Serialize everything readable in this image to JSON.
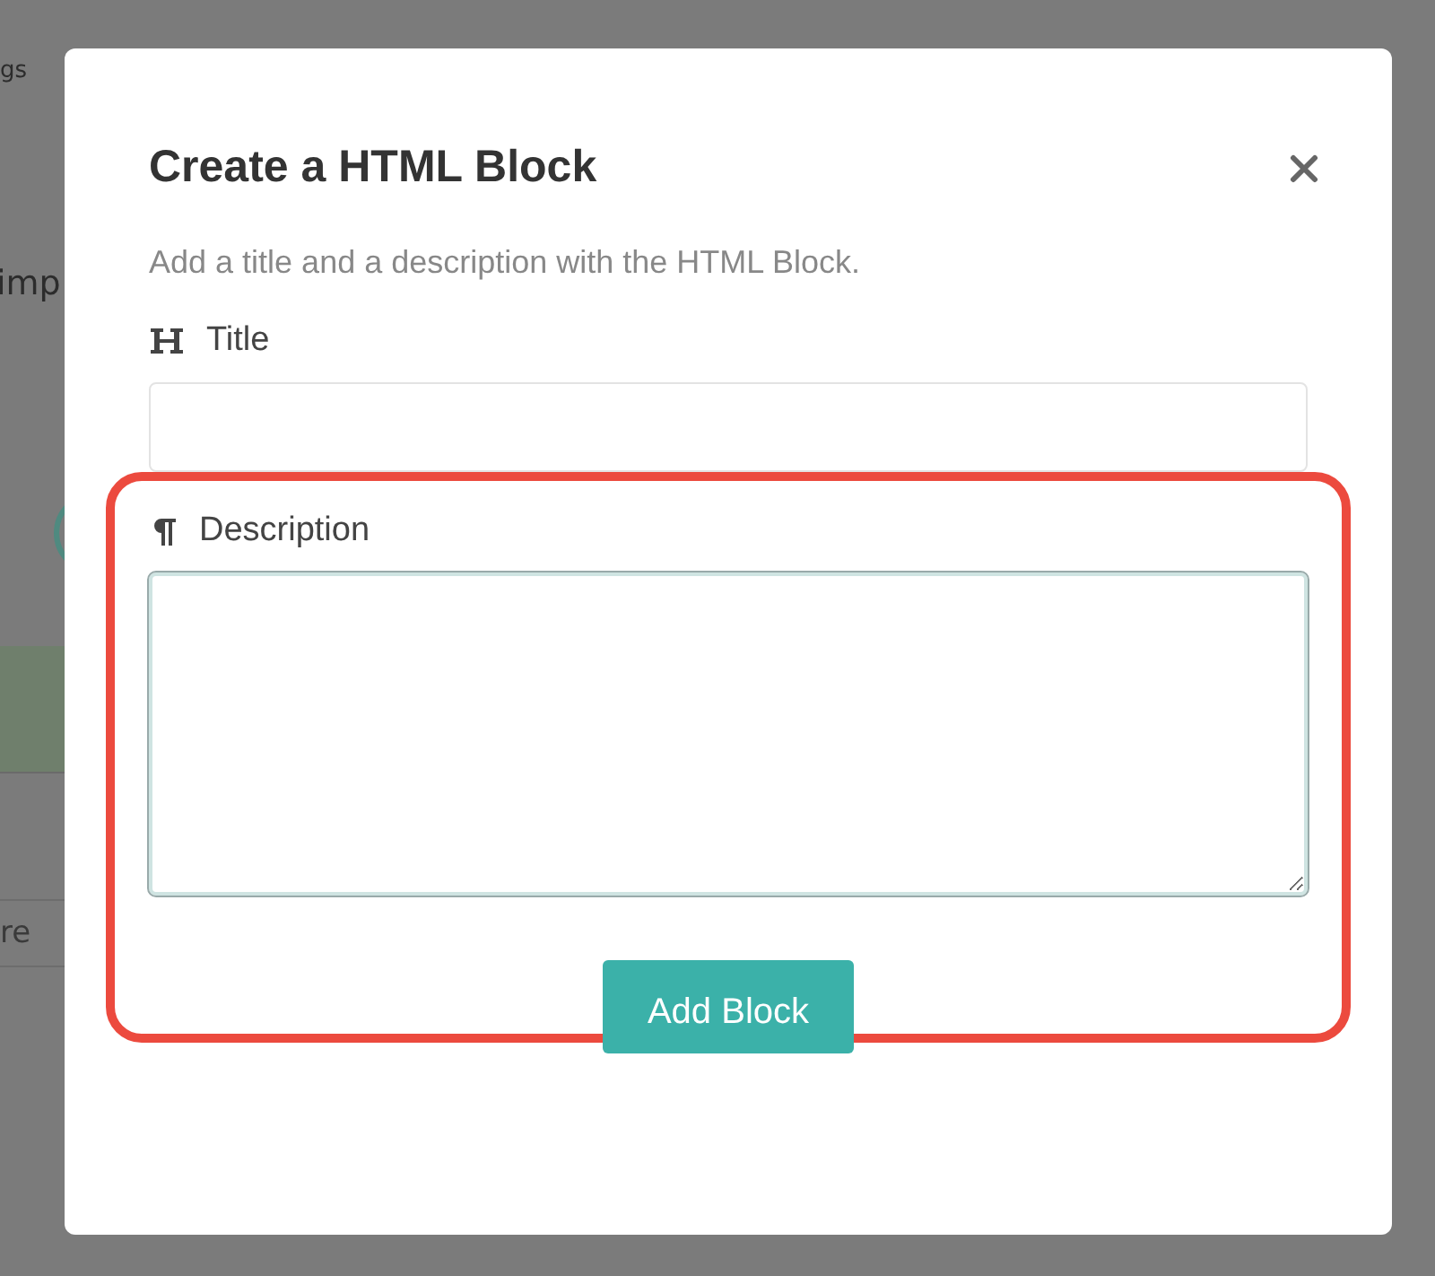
{
  "background": {
    "texts": [
      "gs",
      "imp",
      "re"
    ]
  },
  "dialog": {
    "title": "Create a HTML Block",
    "description": "Add a title and a description with the HTML Block.",
    "fields": [
      {
        "kind": "line",
        "label": "Title"
      },
      {
        "kind": "area",
        "label": "Description",
        "highlighted": true
      }
    ],
    "button": "Add Block"
  }
}
